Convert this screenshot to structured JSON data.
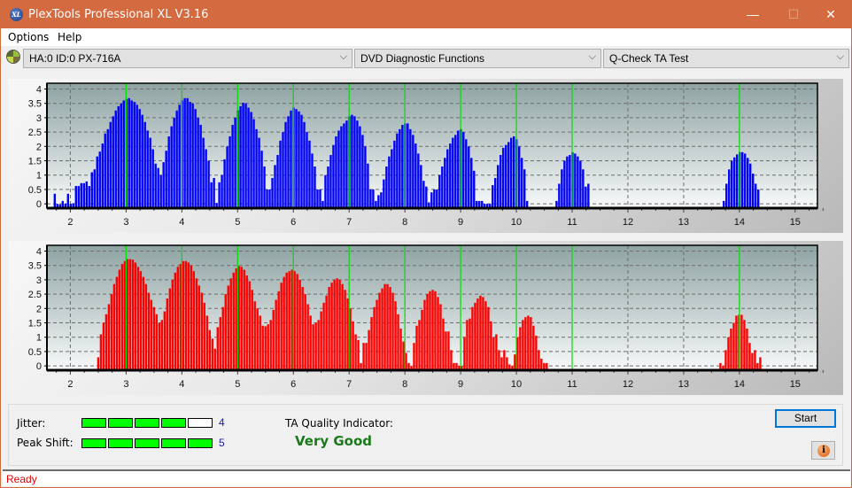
{
  "window": {
    "title": "PlexTools Professional XL V3.16",
    "app_icon": "xl-logo-icon",
    "controls": {
      "minimize": "—",
      "maximize": "☐",
      "close": "✕"
    }
  },
  "menu": [
    {
      "label": "Options"
    },
    {
      "label": "Help"
    }
  ],
  "toolbar": {
    "drive_icon": "disc-drive-icon",
    "drive_select": "HA:0 ID:0  PX-716A",
    "function_select": "DVD Diagnostic Functions",
    "test_select": "Q-Check TA Test",
    "chevron": "⌵"
  },
  "chart_data": [
    {
      "type": "bar",
      "name": "jitter-histogram",
      "color": "#0000ff",
      "marker_color": "#00e000",
      "x_ticks": [
        "2",
        "3",
        "4",
        "5",
        "6",
        "7",
        "8",
        "9",
        "10",
        "11",
        "12",
        "13",
        "14",
        "15"
      ],
      "y_ticks": [
        "4",
        "3.5",
        "3",
        "2.5",
        "2",
        "1.5",
        "1",
        "0.5",
        "0"
      ],
      "xlim": [
        1.58,
        15.4
      ],
      "ylim": [
        -0.15,
        4.2
      ],
      "markers": [
        3,
        4,
        5,
        6,
        7,
        8,
        9,
        10,
        11,
        14
      ],
      "step": 0.0476,
      "segments": [
        {
          "start": 1.72,
          "values": [
            0.35,
            0,
            -0.05,
            0.1,
            0.01,
            0.35,
            0,
            0.02,
            0.62,
            0.62,
            0.72,
            0.72,
            0.78,
            0.62,
            1.1,
            1.2,
            1.65,
            1.82,
            2.1,
            2.45,
            2.6,
            2.85,
            3.05,
            3.25,
            3.4,
            3.5,
            3.6,
            3.65,
            3.68,
            3.6,
            3.55,
            3.45,
            3.3,
            3.1,
            2.85,
            2.55,
            2.3,
            1.9,
            1.4,
            1.25,
            1.0,
            1.45,
            1.85,
            2.35,
            2.7,
            3.0,
            3.25,
            3.45,
            3.6,
            3.68,
            3.68,
            3.55,
            3.5,
            3.3,
            3.0,
            2.75,
            2.3,
            1.9,
            1.5,
            0.75,
            0.9,
            0.03,
            0.75,
            1.0,
            1.55,
            2.0,
            2.35,
            2.75,
            3.0,
            3.25,
            3.4,
            3.52,
            3.5,
            3.35,
            3.2,
            2.95,
            2.6,
            2.3,
            1.85,
            1.3,
            0.5,
            0.5,
            0.9,
            1.35,
            1.7,
            2.2,
            2.5,
            2.85,
            3.05,
            3.25,
            3.35,
            3.3,
            3.22,
            3.1,
            2.85,
            2.5,
            2.2,
            1.75,
            1.3,
            0.5,
            0.5,
            0.1,
            1.0,
            1.3,
            1.7,
            2.05,
            2.35,
            2.55,
            2.7,
            2.8,
            2.9,
            3.05,
            3.1,
            3.05,
            2.9,
            2.7,
            2.4,
            2.0,
            1.4,
            0.5,
            0.5,
            0.1,
            0.3,
            0.4,
            0.85,
            1.3,
            1.65,
            1.9,
            2.2,
            2.45,
            2.6,
            2.75,
            2.8,
            2.8,
            2.6,
            2.4,
            2.1,
            1.75,
            1.35,
            0.8,
            0.6,
            0.05,
            0.4,
            0.5,
            0.5,
            1.0,
            1.3,
            1.6,
            1.9,
            2.1,
            2.3,
            2.4,
            2.55,
            2.6,
            2.5,
            2.25,
            2.0,
            1.6,
            1.15,
            0.1,
            0.1,
            0.1,
            0,
            0,
            0,
            0.65,
            0.9,
            1.35,
            1.7,
            1.95,
            2.05,
            2.15,
            2.3,
            2.35,
            2.25,
            2.0,
            1.6,
            1.2,
            0.1
          ]
        },
        {
          "start": 10.72,
          "values": [
            0.1,
            0.7,
            1.2,
            1.5,
            1.65,
            1.7,
            1.8,
            1.75,
            1.65,
            1.5,
            1.2,
            0.6,
            0.7
          ]
        },
        {
          "start": 13.72,
          "values": [
            0.1,
            0.7,
            1.2,
            1.5,
            1.62,
            1.72,
            1.8,
            1.8,
            1.75,
            1.6,
            1.4,
            1.05,
            0.7,
            0.5
          ]
        }
      ]
    },
    {
      "type": "bar",
      "name": "peak-shift-histogram",
      "color": "#ff0000",
      "marker_color": "#00e000",
      "x_ticks": [
        "2",
        "3",
        "4",
        "5",
        "6",
        "7",
        "8",
        "9",
        "10",
        "11",
        "12",
        "13",
        "14",
        "15"
      ],
      "y_ticks": [
        "4",
        "3.5",
        "3",
        "2.5",
        "2",
        "1.5",
        "1",
        "0.5",
        "0"
      ],
      "xlim": [
        1.58,
        15.4
      ],
      "ylim": [
        -0.15,
        4.2
      ],
      "markers": [
        3,
        4,
        5,
        6,
        7,
        8,
        9,
        10,
        11,
        14
      ],
      "step": 0.0476,
      "segments": [
        {
          "start": 2.5,
          "values": [
            0.3,
            1.1,
            1.5,
            1.8,
            2.15,
            2.5,
            2.85,
            3.1,
            3.35,
            3.55,
            3.65,
            3.72,
            3.72,
            3.7,
            3.6,
            3.45,
            3.3,
            3.1,
            2.85,
            2.55,
            2.3,
            2.05,
            1.8,
            1.5,
            1.6,
            1.9,
            2.35,
            2.7,
            3.0,
            3.25,
            3.45,
            3.55,
            3.65,
            3.65,
            3.6,
            3.5,
            3.3,
            3.05,
            2.8,
            2.55,
            2.2,
            1.75,
            1.25,
            0.95,
            0.6,
            1.35,
            1.7,
            2.05,
            2.5,
            2.8,
            3.05,
            3.25,
            3.4,
            3.48,
            3.45,
            3.35,
            3.15,
            2.95,
            2.65,
            2.25,
            2.0,
            1.75,
            1.4,
            1.38,
            1.45,
            1.6,
            1.95,
            2.3,
            2.6,
            2.9,
            3.1,
            3.25,
            3.3,
            3.35,
            3.3,
            3.2,
            3.0,
            2.75,
            2.5,
            2.15,
            1.75,
            1.45,
            1.5,
            1.6,
            1.9,
            2.2,
            2.45,
            2.75,
            2.9,
            3.0,
            3.05,
            3.0,
            2.85,
            2.65,
            2.35,
            2.0,
            1.55,
            1.1,
            0.9,
            0.1,
            0.8,
            0.8,
            1.25,
            1.7,
            2.05,
            2.3,
            2.55,
            2.7,
            2.85,
            2.85,
            2.75,
            2.55,
            2.25,
            1.8,
            1.3,
            0.85,
            0.45,
            0.1,
            0,
            0.8,
            1.4,
            1.6,
            1.95,
            2.3,
            2.5,
            2.6,
            2.65,
            2.6,
            2.4,
            2.15,
            1.65,
            1.2,
            1.2,
            0.55,
            0.1,
            0.1,
            0,
            0,
            1.0,
            1.6,
            1.65,
            2.05,
            2.2,
            2.35,
            2.45,
            2.4,
            2.25,
            2.05,
            1.55,
            1.0,
            1.1,
            0.55,
            0.3,
            0.55,
            0.3,
            0.05,
            0,
            0.4,
            1.0,
            1.35,
            1.6,
            1.7,
            1.75,
            1.7,
            1.4,
            1.05,
            0.55,
            0.25,
            0.1,
            0.1
          ]
        },
        {
          "start": 13.66,
          "values": [
            0.1,
            0,
            0.55,
            1.0,
            1.3,
            1.5,
            1.75,
            1.78,
            1.78,
            1.6,
            1.3,
            0.8,
            0.45,
            0.55,
            0.1,
            0.3
          ]
        }
      ]
    }
  ],
  "meters": {
    "jitter": {
      "label": "Jitter:",
      "value": "4",
      "segments_on": 4,
      "segments_total": 5
    },
    "peak_shift": {
      "label": "Peak Shift:",
      "value": "5",
      "segments_on": 5,
      "segments_total": 5
    }
  },
  "quality": {
    "label": "TA Quality Indicator:",
    "value": "Very Good"
  },
  "buttons": {
    "start": "Start",
    "info_icon": "info-icon",
    "info_glyph": "i"
  },
  "status": {
    "text": "Ready"
  }
}
